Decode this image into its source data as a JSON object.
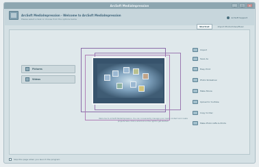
{
  "window": {
    "title": "ArcSoft MediaImpression",
    "buttons": [
      "_",
      "□",
      "×"
    ]
  },
  "header": {
    "app_name": "ArcSoft MediaImpression - Welcome to ArcSoft MediaImpression",
    "subtitle": "Please select a task or choose from the options below",
    "support_label": "ArcSoft Support"
  },
  "tabs": [
    {
      "label": "Shortcut",
      "active": true
    },
    {
      "label": "Import Photo/Video/Music",
      "active": false
    }
  ],
  "left_buttons": [
    {
      "label": "Pictures",
      "icon": "pictures-icon"
    },
    {
      "label": "Videos",
      "icon": "videos-icon"
    }
  ],
  "welcome_text": "Welcome to ArcSoft MediaImpression. You can conveniently manage your media content and create projects here. Click a shortcut on the right to get started.",
  "menu_items": [
    {
      "label": "Import",
      "icon": "import-icon"
    },
    {
      "label": "Save As",
      "icon": "save-as-icon"
    },
    {
      "label": "Easy Print",
      "icon": "print-icon"
    },
    {
      "label": "Photo Slideshow",
      "icon": "slideshow-icon"
    },
    {
      "label": "Make Movie",
      "icon": "movie-icon"
    },
    {
      "label": "Upload to YouTube",
      "icon": "youtube-icon"
    },
    {
      "label": "Copy to Disc",
      "icon": "disc-icon"
    },
    {
      "label": "Make Photo Gifts & Prints",
      "icon": "gift-icon"
    }
  ],
  "statusbar": {
    "checkbox_label": "Skip this page when you launch the program"
  },
  "colors": {
    "accent": "#8a6aa8",
    "titlebar": "#8da6b0"
  }
}
